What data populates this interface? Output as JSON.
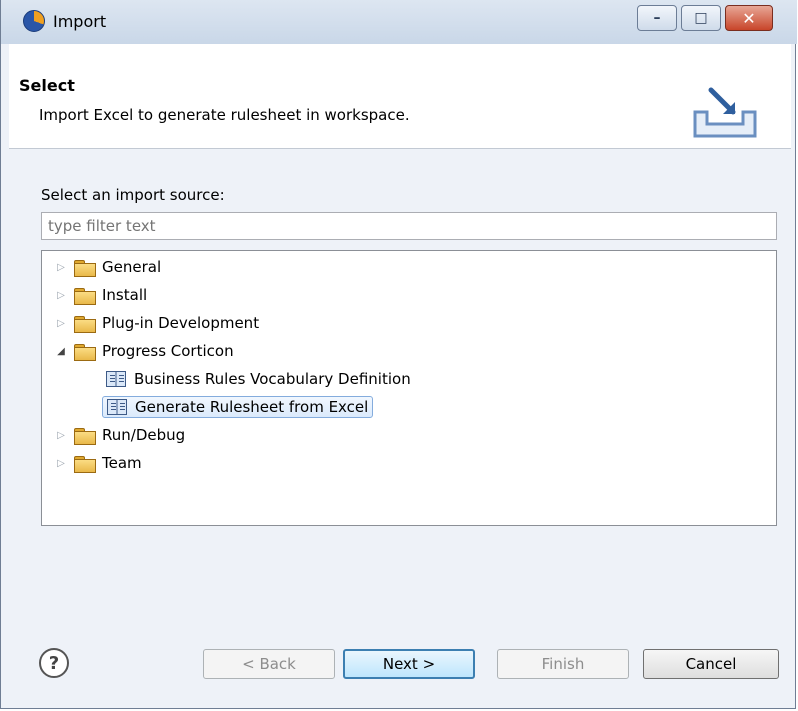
{
  "window": {
    "title": "Import",
    "buttons": {
      "minimize": "–",
      "maximize": "□",
      "close": "✕"
    }
  },
  "header": {
    "title": "Select",
    "description": "Import Excel to generate rulesheet in workspace."
  },
  "body": {
    "source_label": "Select an import source:",
    "filter_placeholder": "type filter text",
    "tree": [
      {
        "label": "General",
        "expanded": false,
        "type": "folder"
      },
      {
        "label": "Install",
        "expanded": false,
        "type": "folder"
      },
      {
        "label": "Plug-in Development",
        "expanded": false,
        "type": "folder"
      },
      {
        "label": "Progress Corticon",
        "expanded": true,
        "type": "folder",
        "children": [
          {
            "label": "Business Rules Vocabulary Definition",
            "type": "wizard",
            "selected": false
          },
          {
            "label": "Generate Rulesheet from Excel",
            "type": "wizard",
            "selected": true
          }
        ]
      },
      {
        "label": "Run/Debug",
        "expanded": false,
        "type": "folder"
      },
      {
        "label": "Team",
        "expanded": false,
        "type": "folder"
      }
    ]
  },
  "footer": {
    "help_symbol": "?",
    "back_label": "< Back",
    "next_label": "Next >",
    "finish_label": "Finish",
    "cancel_label": "Cancel"
  },
  "icons": {
    "app": "eclipse-icon",
    "banner": "import-wizard-banner-icon",
    "folder": "folder-icon",
    "wizard": "book-icon",
    "collapsed": "tree-collapsed-icon",
    "expanded": "tree-expanded-icon",
    "help": "help-icon"
  }
}
